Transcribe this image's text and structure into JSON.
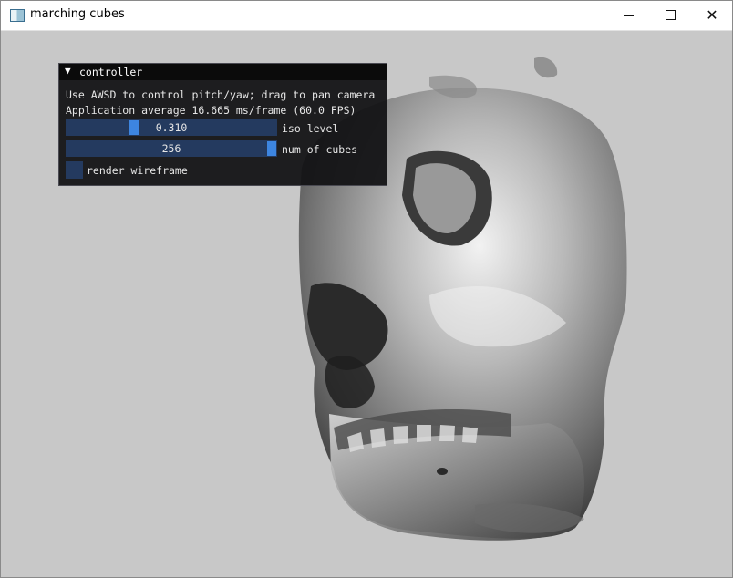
{
  "window": {
    "title": "marching cubes"
  },
  "controller": {
    "header": "controller",
    "instructions": "Use AWSD to control pitch/yaw; drag to pan camera",
    "stats": "Application average 16.665 ms/frame (60.0 FPS)",
    "iso_level": {
      "value": "0.310",
      "label": "iso level",
      "fraction": 0.33
    },
    "num_cubes": {
      "value": "256",
      "label": "num of cubes",
      "fraction": 1.0
    },
    "wireframe": {
      "label": "render wireframe",
      "checked": false
    }
  },
  "colors": {
    "panel_bg": "#121214",
    "slider_bg": "#243a5f",
    "slider_grab": "#3d85e0",
    "viewport_bg": "#c8c8c8"
  }
}
